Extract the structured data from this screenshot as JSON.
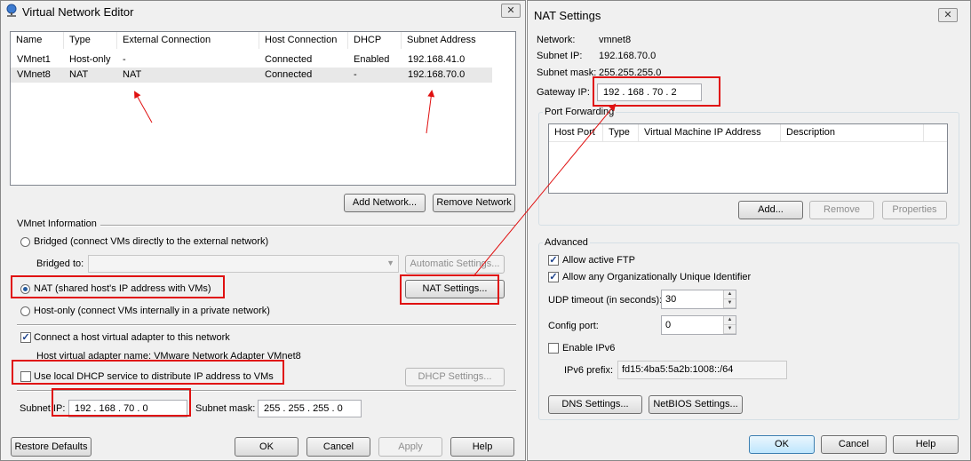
{
  "vne": {
    "title": "Virtual Network Editor",
    "close": "✕",
    "columns": [
      "Name",
      "Type",
      "External Connection",
      "Host Connection",
      "DHCP",
      "Subnet Address"
    ],
    "rows": [
      [
        "VMnet1",
        "Host-only",
        "-",
        "Connected",
        "Enabled",
        "192.168.41.0"
      ],
      [
        "VMnet8",
        "NAT",
        "NAT",
        "Connected",
        "-",
        "192.168.70.0"
      ]
    ],
    "add_network": "Add Network...",
    "remove_network": "Remove Network",
    "vmnet_info": "VMnet Information",
    "bridged": "Bridged (connect VMs directly to the external network)",
    "bridged_to": "Bridged to:",
    "automatic_settings": "Automatic Settings...",
    "nat": "NAT (shared host's IP address with VMs)",
    "nat_settings": "NAT Settings...",
    "host_only": "Host-only (connect VMs internally in a private network)",
    "connect_adapter": "Connect a host virtual adapter to this network",
    "adapter_name": "Host virtual adapter name: VMware Network Adapter VMnet8",
    "use_dhcp": "Use local DHCP service to distribute IP address to VMs",
    "dhcp_settings": "DHCP Settings...",
    "subnet_ip_label": "Subnet IP:",
    "subnet_ip": [
      "192",
      "168",
      "70",
      "0"
    ],
    "subnet_mask_label": "Subnet mask:",
    "subnet_mask": [
      "255",
      "255",
      "255",
      "0"
    ],
    "restore_defaults": "Restore Defaults",
    "ok": "OK",
    "cancel": "Cancel",
    "apply": "Apply",
    "help": "Help"
  },
  "nat": {
    "title": "NAT Settings",
    "close": "✕",
    "network_label": "Network:",
    "network": "vmnet8",
    "subnet_ip_label": "Subnet IP:",
    "subnet_ip": "192.168.70.0",
    "subnet_mask_label": "Subnet mask:",
    "subnet_mask": "255.255.255.0",
    "gateway_label": "Gateway IP:",
    "gateway": [
      "192",
      "168",
      "70",
      "2"
    ],
    "port_forwarding": "Port Forwarding",
    "pf_columns": [
      "Host Port",
      "Type",
      "Virtual Machine IP Address",
      "Description"
    ],
    "add": "Add...",
    "remove": "Remove",
    "properties": "Properties",
    "advanced": "Advanced",
    "allow_ftp": "Allow active FTP",
    "allow_oui": "Allow any Organizationally Unique Identifier",
    "udp_label": "UDP timeout (in seconds):",
    "udp_value": "30",
    "config_port_label": "Config port:",
    "config_port_value": "0",
    "enable_ipv6": "Enable IPv6",
    "ipv6_prefix_label": "IPv6 prefix:",
    "ipv6_prefix": "fd15:4ba5:5a2b:1008::/64",
    "dns_settings": "DNS Settings...",
    "netbios_settings": "NetBIOS Settings...",
    "ok": "OK",
    "cancel": "Cancel",
    "help": "Help"
  },
  "colors": {
    "annotation": "#e01010",
    "selection": "#e8e8e8"
  }
}
